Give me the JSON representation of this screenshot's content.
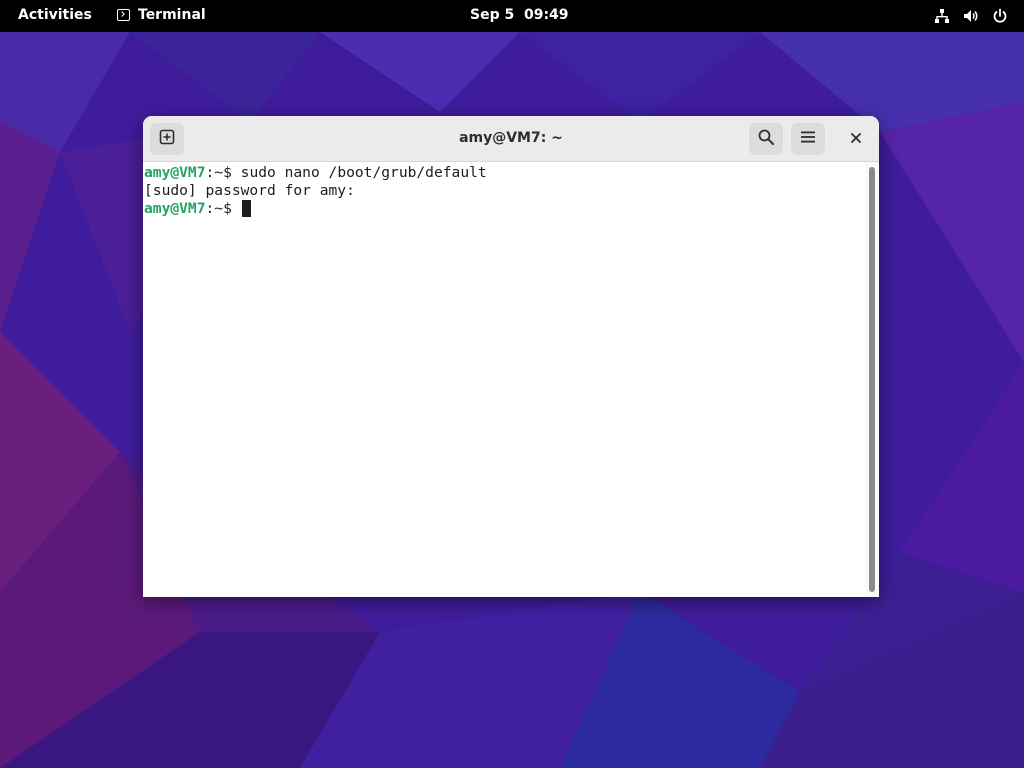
{
  "topbar": {
    "activities": "Activities",
    "app_name": "Terminal",
    "app_icon": "terminal-icon",
    "clock": "Sep 5  09:49",
    "status_icons": [
      "network-icon",
      "volume-icon",
      "power-icon"
    ]
  },
  "window": {
    "title": "amy@VM7: ~",
    "buttons": {
      "new_tab": "new-tab-icon",
      "search": "search-icon",
      "menu": "hamburger-menu-icon",
      "close": "close-icon"
    }
  },
  "terminal": {
    "lines": [
      {
        "user": "amy@VM7",
        "path": ":~",
        "symbol": "$ ",
        "command": "sudo nano /boot/grub/default"
      },
      {
        "text": "[sudo] password for amy:"
      },
      {
        "user": "amy@VM7",
        "path": ":~",
        "symbol": "$ ",
        "command": ""
      }
    ]
  },
  "colors": {
    "prompt_user": "#26a269",
    "prompt_path": "#2a7bde",
    "topbar_bg": "#000000",
    "headerbar_bg": "#ebebeb"
  }
}
